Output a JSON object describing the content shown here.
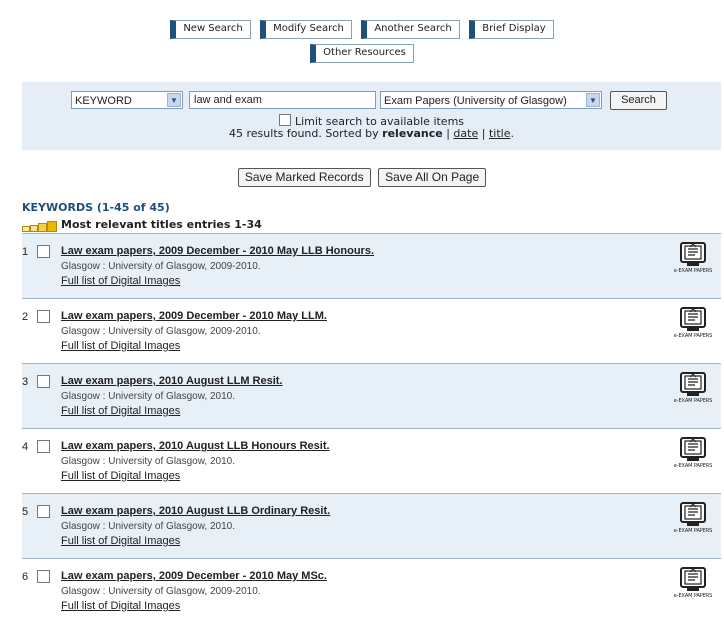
{
  "nav": {
    "row1": [
      "New Search",
      "Modify Search",
      "Another Search",
      "Brief Display"
    ],
    "row2": [
      "Other Resources"
    ]
  },
  "search": {
    "field_select": "KEYWORD",
    "query_value": "law and exam",
    "scope_select": "Exam Papers (University of Glasgow)",
    "search_button": "Search",
    "limit_label": "Limit search to available items",
    "results_prefix": "45 results found. Sorted by",
    "sort_relevance": "relevance",
    "sort_sep1": "|",
    "sort_date": "date",
    "sort_sep2": "|",
    "sort_title": "title",
    "sort_end": "."
  },
  "save": {
    "marked": "Save Marked Records",
    "all": "Save All On Page"
  },
  "keywords_heading": "KEYWORDS (1-45 of 45)",
  "relevance_heading": "Most relevant titles entries 1-34",
  "icon_caption": "e-EXAM PAPERS",
  "records": [
    {
      "num": "1",
      "title": "Law exam papers, 2009 December - 2010 May LLB Honours.",
      "pub": "Glasgow : University of Glasgow, 2009-2010.",
      "link": "Full list of Digital Images"
    },
    {
      "num": "2",
      "title": "Law exam papers, 2009 December - 2010 May LLM.",
      "pub": "Glasgow : University of Glasgow, 2009-2010.",
      "link": "Full list of Digital Images"
    },
    {
      "num": "3",
      "title": "Law exam papers, 2010 August LLM Resit.",
      "pub": "Glasgow : University of Glasgow, 2010.",
      "link": "Full list of Digital Images"
    },
    {
      "num": "4",
      "title": "Law exam papers, 2010 August LLB Honours Resit.",
      "pub": "Glasgow : University of Glasgow, 2010.",
      "link": "Full list of Digital Images"
    },
    {
      "num": "5",
      "title": "Law exam papers, 2010 August LLB Ordinary Resit.",
      "pub": "Glasgow : University of Glasgow, 2010.",
      "link": "Full list of Digital Images"
    },
    {
      "num": "6",
      "title": "Law exam papers, 2009 December - 2010 May MSc.",
      "pub": "Glasgow : University of Glasgow, 2009-2010.",
      "link": "Full list of Digital Images"
    }
  ]
}
